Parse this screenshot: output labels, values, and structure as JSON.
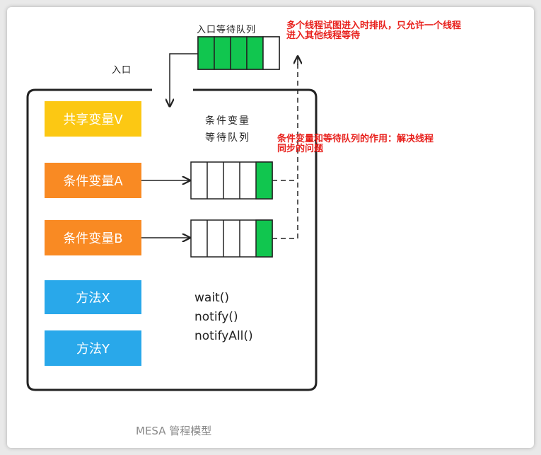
{
  "diagram": {
    "entry_queue_label": "入口等待队列",
    "entry_label": "入口",
    "cond_queue_label_line1": "条件变量",
    "cond_queue_label_line2": "等待队列",
    "shared_var": "共享变量V",
    "cond_a": "条件变量A",
    "cond_b": "条件变量B",
    "method_x": "方法X",
    "method_y": "方法Y",
    "methods": [
      "wait()",
      "notify()",
      "notifyAll()"
    ],
    "note1_line1": "多个线程试图进入时排队，只允许一个线程",
    "note1_line2": "进入其他线程等待",
    "note2_line1": "条件变量和等待队列的作用：解决线程",
    "note2_line2": "同步的问题",
    "caption": "MESA 管程模型"
  },
  "colors": {
    "shared_var_bg": "#fcc813",
    "cond_bg": "#f98a23",
    "method_bg": "#29a8ea",
    "queue_filled": "#11c64f",
    "note_red": "#e8201c"
  }
}
